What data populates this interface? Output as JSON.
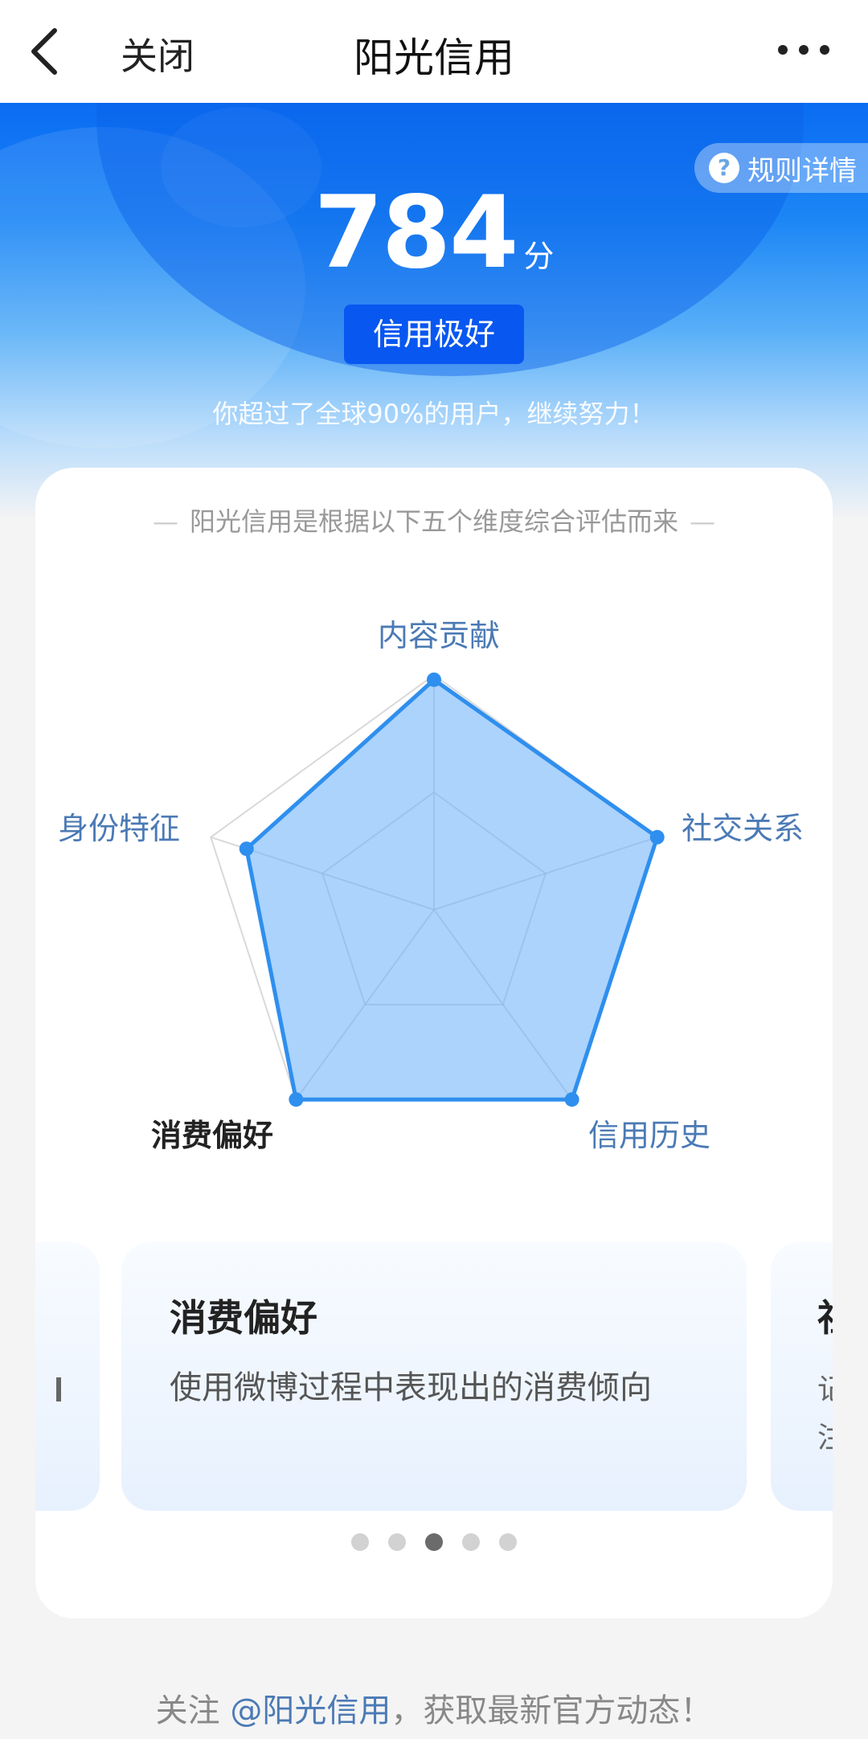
{
  "nav": {
    "close_label": "关闭",
    "title": "阳光信用",
    "back_icon": "chevron-left-icon",
    "more_icon": "more-horizontal-icon"
  },
  "hero": {
    "rules_label": "规则详情",
    "rules_icon": "question-circle-icon",
    "score": "784",
    "score_unit": "分",
    "level": "信用极好",
    "subtitle": "你超过了全球90%的用户，继续努力！"
  },
  "card": {
    "heading": "阳光信用是根据以下五个维度综合评估而来",
    "dimensions": [
      {
        "label": "内容贡献",
        "value": 0.98,
        "active": false
      },
      {
        "label": "社交关系",
        "value": 1.0,
        "active": false
      },
      {
        "label": "信用历史",
        "value": 1.0,
        "active": false
      },
      {
        "label": "消费偏好",
        "value": 1.0,
        "active": true
      },
      {
        "label": "身份特征",
        "value": 0.84,
        "active": false
      }
    ],
    "active_tile": {
      "title": "消费偏好",
      "description": "使用微博过程中表现出的消费倾向"
    },
    "next_tile_peek": {
      "title": "社",
      "line1": "记",
      "line2": "注"
    },
    "pager": {
      "count": 5,
      "active_index": 2
    }
  },
  "footer": {
    "prefix": "关注 ",
    "link": "@阳光信用",
    "suffix": "，获取最新官方动态！"
  },
  "colors": {
    "brand_blue": "#0857f0",
    "radar_stroke": "#2f8fee",
    "radar_fill": "#a8d1fb",
    "label_blue": "#4b7ab5"
  }
}
